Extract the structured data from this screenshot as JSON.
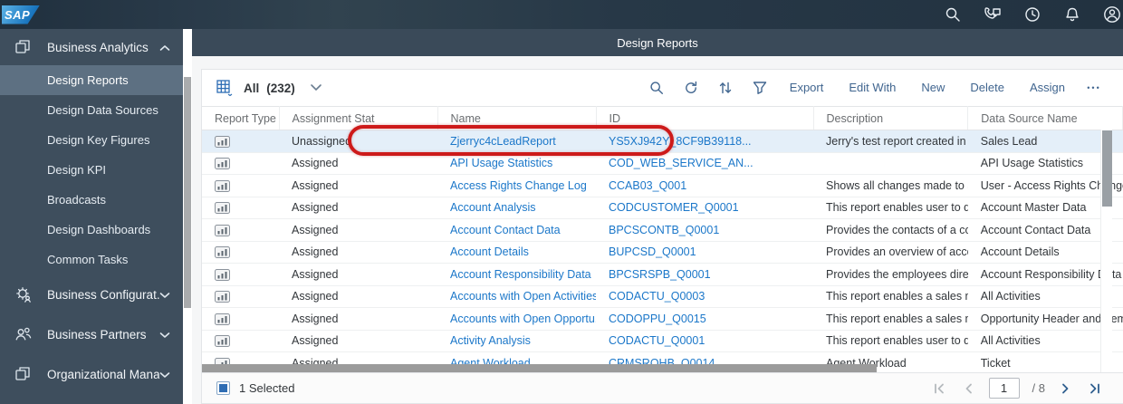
{
  "shell": {
    "logo": "SAP",
    "icons": [
      "search-icon",
      "call-chat-icon",
      "time-icon",
      "notifications-icon",
      "account-icon"
    ]
  },
  "app_title": "Design Reports",
  "sidebar": {
    "group_top": {
      "label": "Business Analytics"
    },
    "items": [
      {
        "label": "Design Reports",
        "selected": true
      },
      {
        "label": "Design Data Sources"
      },
      {
        "label": "Design Key Figures"
      },
      {
        "label": "Design KPI"
      },
      {
        "label": "Broadcasts"
      },
      {
        "label": "Design Dashboards"
      },
      {
        "label": "Common Tasks"
      }
    ],
    "groups_bottom": [
      {
        "label": "Business Configurat..."
      },
      {
        "label": "Business Partners"
      },
      {
        "label": "Organizational Mana..."
      }
    ]
  },
  "toolbar": {
    "view": "All",
    "count": "(232)",
    "icons": [
      "search-icon",
      "refresh-icon",
      "sort-icon",
      "filter-icon"
    ],
    "buttons": [
      {
        "label": "Export"
      },
      {
        "label": "Edit With"
      },
      {
        "label": "New"
      },
      {
        "label": "Delete"
      },
      {
        "label": "Assign"
      }
    ],
    "overflow": "•••"
  },
  "table": {
    "columns": [
      {
        "label": "Report Type"
      },
      {
        "label": "Assignment Stat"
      },
      {
        "label": "Name"
      },
      {
        "label": "ID"
      },
      {
        "label": "Description"
      },
      {
        "label": "Data Source Name"
      }
    ],
    "rows": [
      {
        "assignment": "Unassigned",
        "name": "Zjerryc4cLeadReport",
        "id": "YS5XJ942Y_8CF9B39118...",
        "description": "Jerry's test report created in Cloud for Cu...",
        "data_source": "Sales Lead",
        "selected": true
      },
      {
        "assignment": "Assigned",
        "name": "API Usage Statistics",
        "id": "COD_WEB_SERVICE_AN...",
        "description": "",
        "data_source": "API Usage Statistics"
      },
      {
        "assignment": "Assigned",
        "name": "Access Rights Change Log",
        "id": "CCAB03_Q001",
        "description": "Shows all changes made to access rights ...",
        "data_source": "User - Access Rights Change Documents"
      },
      {
        "assignment": "Assigned",
        "name": "Account Analysis",
        "id": "CODCUSTOMER_Q0001",
        "description": "This report enables user to do account an...",
        "data_source": "Account Master Data"
      },
      {
        "assignment": "Assigned",
        "name": "Account Contact Data",
        "id": "BPCSCONTB_Q0001",
        "description": "Provides the contacts of a corporate acco...",
        "data_source": "Account Contact Data"
      },
      {
        "assignment": "Assigned",
        "name": "Account Details",
        "id": "BUPCSD_Q0001",
        "description": "Provides an overview of account master d...",
        "data_source": "Account Details"
      },
      {
        "assignment": "Assigned",
        "name": "Account Responsibility Data",
        "id": "BPCSRSPB_Q0001",
        "description": "Provides the employees directly responsi...",
        "data_source": "Account Responsibility Data"
      },
      {
        "assignment": "Assigned",
        "name": "Accounts with Open Activities",
        "id": "CODACTU_Q0003",
        "description": "This report enables a sales manager and ...",
        "data_source": "All Activities"
      },
      {
        "assignment": "Assigned",
        "name": "Accounts with Open Opportu...",
        "id": "CODOPPU_Q0015",
        "description": "This report enables a sales manager and ...",
        "data_source": "Opportunity Header and Item"
      },
      {
        "assignment": "Assigned",
        "name": "Activity Analysis",
        "id": "CODACTU_Q0001",
        "description": "This report enables user to do activity ana...",
        "data_source": "All Activities"
      },
      {
        "assignment": "Assigned",
        "name": "Agent Workload",
        "id": "CRMSROHB_Q0014",
        "description": "Agent Workload",
        "data_source": "Ticket"
      }
    ]
  },
  "footer": {
    "selected_text": "1 Selected",
    "page": "1",
    "total": "/ 8"
  },
  "colors": {
    "shell_bar": "#273847",
    "sidebar": "#3e4e5d",
    "sidebar_selected": "#5d7082",
    "content_header": "#3a4a59",
    "link": "#1b77c9",
    "toolbar_action": "#40658f",
    "selected_row": "#e4eff9",
    "annotation_red": "#cd1a1a"
  }
}
